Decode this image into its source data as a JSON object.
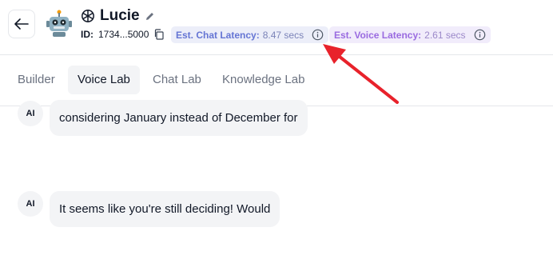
{
  "header": {
    "back_icon": "arrow-left-icon",
    "avatar_icon": "robot-icon",
    "brand_icon": "openai-icon",
    "agent_name": "Lucie",
    "edit_icon": "pencil-icon",
    "id_label": "ID:",
    "id_value": "1734...5000",
    "copy_icon": "copy-icon",
    "chat_latency": {
      "label": "Est. Chat Latency:",
      "value": "8.47 secs",
      "icon": "info-icon"
    },
    "voice_latency": {
      "label": "Est. Voice Latency:",
      "value": "2.61 secs",
      "icon": "info-icon"
    }
  },
  "tabs": [
    {
      "label": "Builder",
      "active": false
    },
    {
      "label": "Voice Lab",
      "active": true
    },
    {
      "label": "Chat Lab",
      "active": false
    },
    {
      "label": "Knowledge Lab",
      "active": false
    }
  ],
  "messages": [
    {
      "sender": "AI",
      "text": "considering January instead of December for"
    },
    {
      "sender": "AI",
      "text": "It seems like you're still deciding! Would"
    }
  ],
  "colors": {
    "annotation_arrow": "#e8222b",
    "chat_latency_bg": "#eceef9",
    "voice_latency_bg": "#f1ecfb"
  }
}
